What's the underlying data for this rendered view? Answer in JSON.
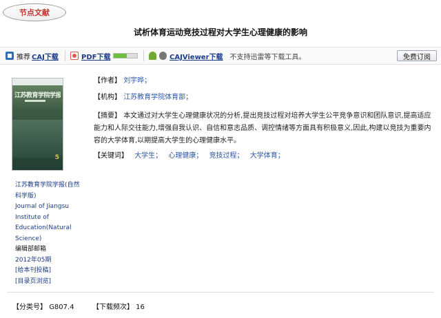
{
  "node_label": "节点文献",
  "title": "试析体育运动竞技过程对大学生心理健康的影响",
  "toolbar": {
    "recommend": "推荐",
    "caj_download": "CAJ下载",
    "pdf_download": "PDF下载",
    "pdf_progress": 0.55,
    "cajviewer_download": "CAJViewer下载",
    "note": "不支持迅雷等下载工具。",
    "subscribe": "免费订阅"
  },
  "article": {
    "author_label": "【作者】",
    "author": "刘宇晔；",
    "institution_label": "【机构】",
    "institution": "江苏教育学院体育部；",
    "abstract_label": "【摘要】",
    "abstract": "本文通过对大学生心理健康状况的分析,提出竞技过程对培养大学生公平竞争意识和团队意识,提高适应能力和人际交往能力,增强自我认识、自信和意志品质、调控情绪等方面具有积极意义,因此,构建以竞技为重要内容的大学体育,以期提高大学生的心理健康水平。",
    "keywords_label": "【关键词】",
    "keywords": [
      "大学生；",
      "心理健康；",
      "竞技过程；",
      "大学体育；"
    ]
  },
  "journal": {
    "cover_title": "江苏教育学院学报",
    "cover_issue": "5",
    "name_cn": "江苏教育学院学报(自然科学版)",
    "name_en": "Journal of Jiangsu Institute of Education(Natural Science)",
    "editor_email": "编辑部邮箱",
    "issue": "2012年05期",
    "submit": "[给本刊投稿]",
    "toc": "[目录页浏览]"
  },
  "footer": {
    "class_label": "【分类号】",
    "class_value": "G807.4",
    "downloads_label": "【下载频次】",
    "downloads_value": "16"
  },
  "colors": {
    "link": "#1a3c8a",
    "accent_red": "#c0392b"
  }
}
